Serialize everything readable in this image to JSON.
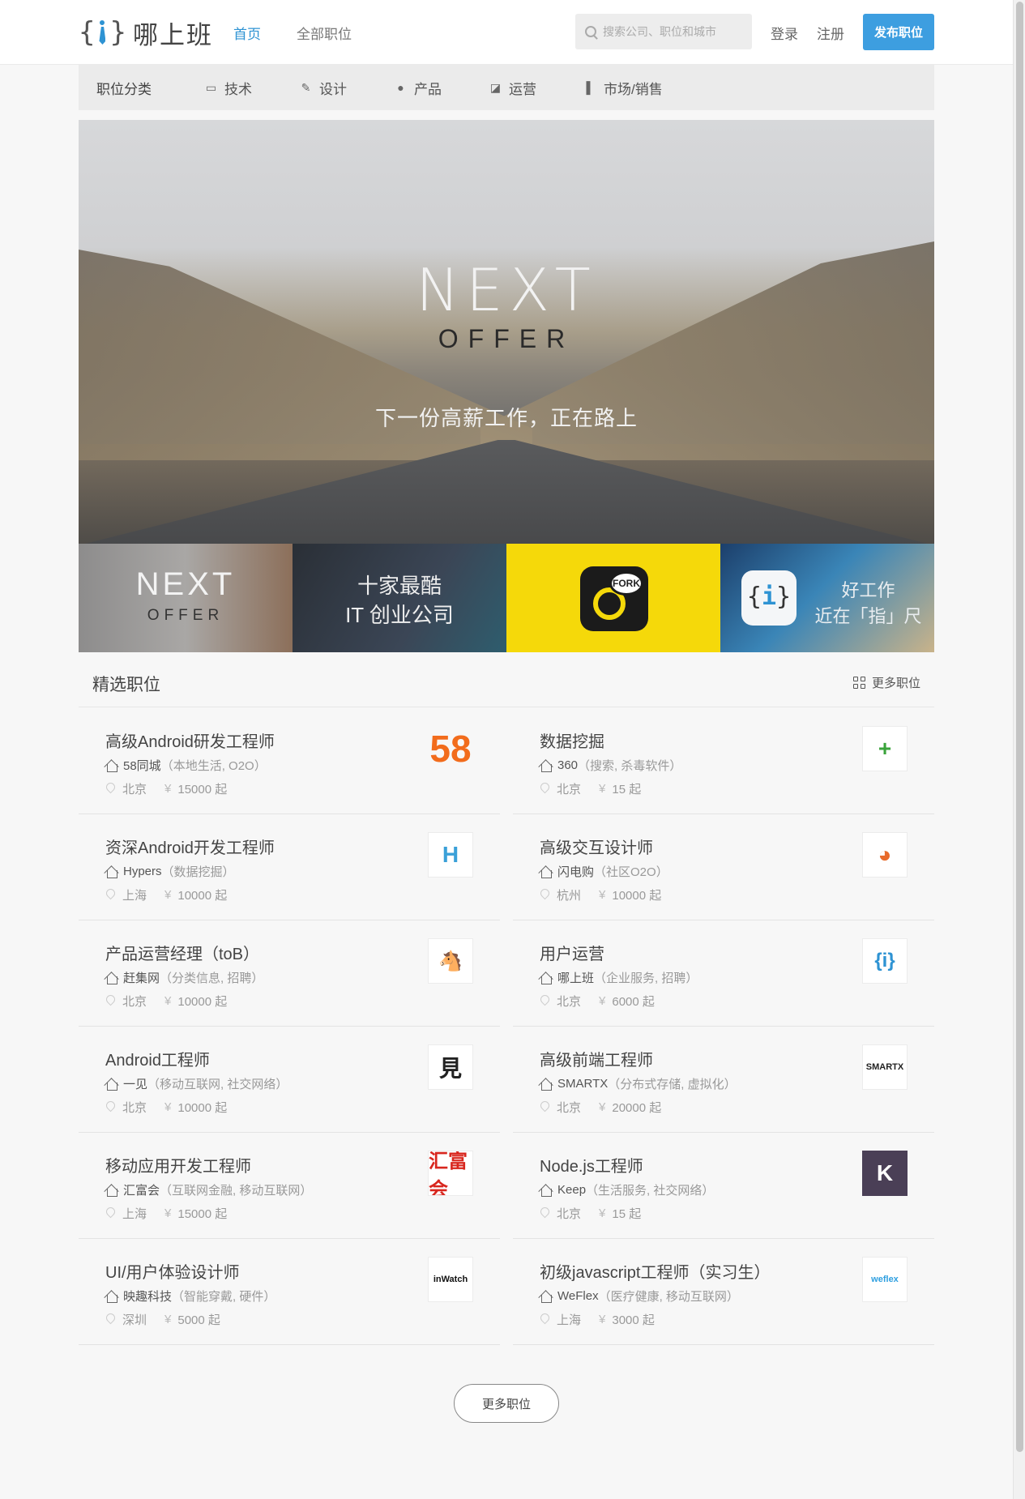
{
  "header": {
    "logo_text": "哪上班",
    "nav": [
      {
        "label": "首页",
        "active": true
      },
      {
        "label": "全部职位",
        "active": false
      }
    ],
    "search_placeholder": "搜索公司、职位和城市",
    "login": "登录",
    "register": "注册",
    "post_job": "发布职位"
  },
  "categories": {
    "label": "职位分类",
    "items": [
      {
        "label": "技术",
        "icon": "terminal-icon"
      },
      {
        "label": "设计",
        "icon": "brush-icon"
      },
      {
        "label": "产品",
        "icon": "bulb-icon"
      },
      {
        "label": "运营",
        "icon": "chart-line-icon"
      },
      {
        "label": "市场/销售",
        "icon": "bar-chart-icon"
      }
    ]
  },
  "hero": {
    "title": "NEXT",
    "subtitle": "OFFER",
    "slogan": "下一份高薪工作，正在路上"
  },
  "tiles": {
    "t1_line1": "NEXT",
    "t1_line2": "OFFER",
    "t2_line1": "十家最酷",
    "t2_line2": "IT 创业公司",
    "t3_label": "FORK",
    "t4_line1": "好工作",
    "t4_line2": "近在「指」尺"
  },
  "featured": {
    "title": "精选职位",
    "more": "更多职位",
    "salary_suffix": "起",
    "jobs": [
      {
        "title": "高级Android研发工程师",
        "company": "58同城",
        "tags": "（本地生活, O2O）",
        "city": "北京",
        "salary": "15000 起",
        "logo": "58",
        "logo_color": "#f26c1c"
      },
      {
        "title": "数据挖掘",
        "company": "360",
        "tags": "（搜索, 杀毒软件）",
        "city": "北京",
        "salary": "15 起",
        "logo": "+",
        "logo_color": "#3aa33b"
      },
      {
        "title": "资深Android开发工程师",
        "company": "Hypers",
        "tags": "（数据挖掘）",
        "city": "上海",
        "salary": "10000 起",
        "logo": "H",
        "logo_color": "#3aa0d8"
      },
      {
        "title": "高级交互设计师",
        "company": "闪电购",
        "tags": "（社区O2O）",
        "city": "杭州",
        "salary": "10000 起",
        "logo": "◕",
        "logo_color": "#e86a2a"
      },
      {
        "title": "产品运营经理（toB）",
        "company": "赶集网",
        "tags": "（分类信息, 招聘）",
        "city": "北京",
        "salary": "10000 起",
        "logo": "🐴",
        "logo_color": "#5a9a2a"
      },
      {
        "title": "用户运营",
        "company": "哪上班",
        "tags": "（企业服务, 招聘）",
        "city": "北京",
        "salary": "6000 起",
        "logo": "{i}",
        "logo_color": "#2e93d3"
      },
      {
        "title": "Android工程师",
        "company": "一见",
        "tags": "（移动互联网, 社交网络）",
        "city": "北京",
        "salary": "10000 起",
        "logo": "見",
        "logo_color": "#222222"
      },
      {
        "title": "高级前端工程师",
        "company": "SMARTX",
        "tags": "（分布式存储, 虚拟化）",
        "city": "北京",
        "salary": "20000 起",
        "logo": "SMARTX",
        "logo_color": "#222222"
      },
      {
        "title": "移动应用开发工程师",
        "company": "汇富会",
        "tags": "（互联网金融, 移动互联网）",
        "city": "上海",
        "salary": "15000 起",
        "logo": "汇富会",
        "logo_color": "#d8261e"
      },
      {
        "title": "Node.js工程师",
        "company": "Keep",
        "tags": "（生活服务, 社交网络）",
        "city": "北京",
        "salary": "15 起",
        "logo": "K",
        "logo_color": "#ffffff"
      },
      {
        "title": "UI/用户体验设计师",
        "company": "映趣科技",
        "tags": "（智能穿戴, 硬件）",
        "city": "深圳",
        "salary": "5000 起",
        "logo": "inWatch",
        "logo_color": "#111111"
      },
      {
        "title": "初级javascript工程师（实习生）",
        "company": "WeFlex",
        "tags": "（医疗健康, 移动互联网）",
        "city": "上海",
        "salary": "3000 起",
        "logo": "weflex",
        "logo_color": "#2e9fe0"
      }
    ]
  },
  "more_button": "更多职位",
  "colors": {
    "accent": "#2e93d3",
    "post_button": "#3d9ee0"
  }
}
